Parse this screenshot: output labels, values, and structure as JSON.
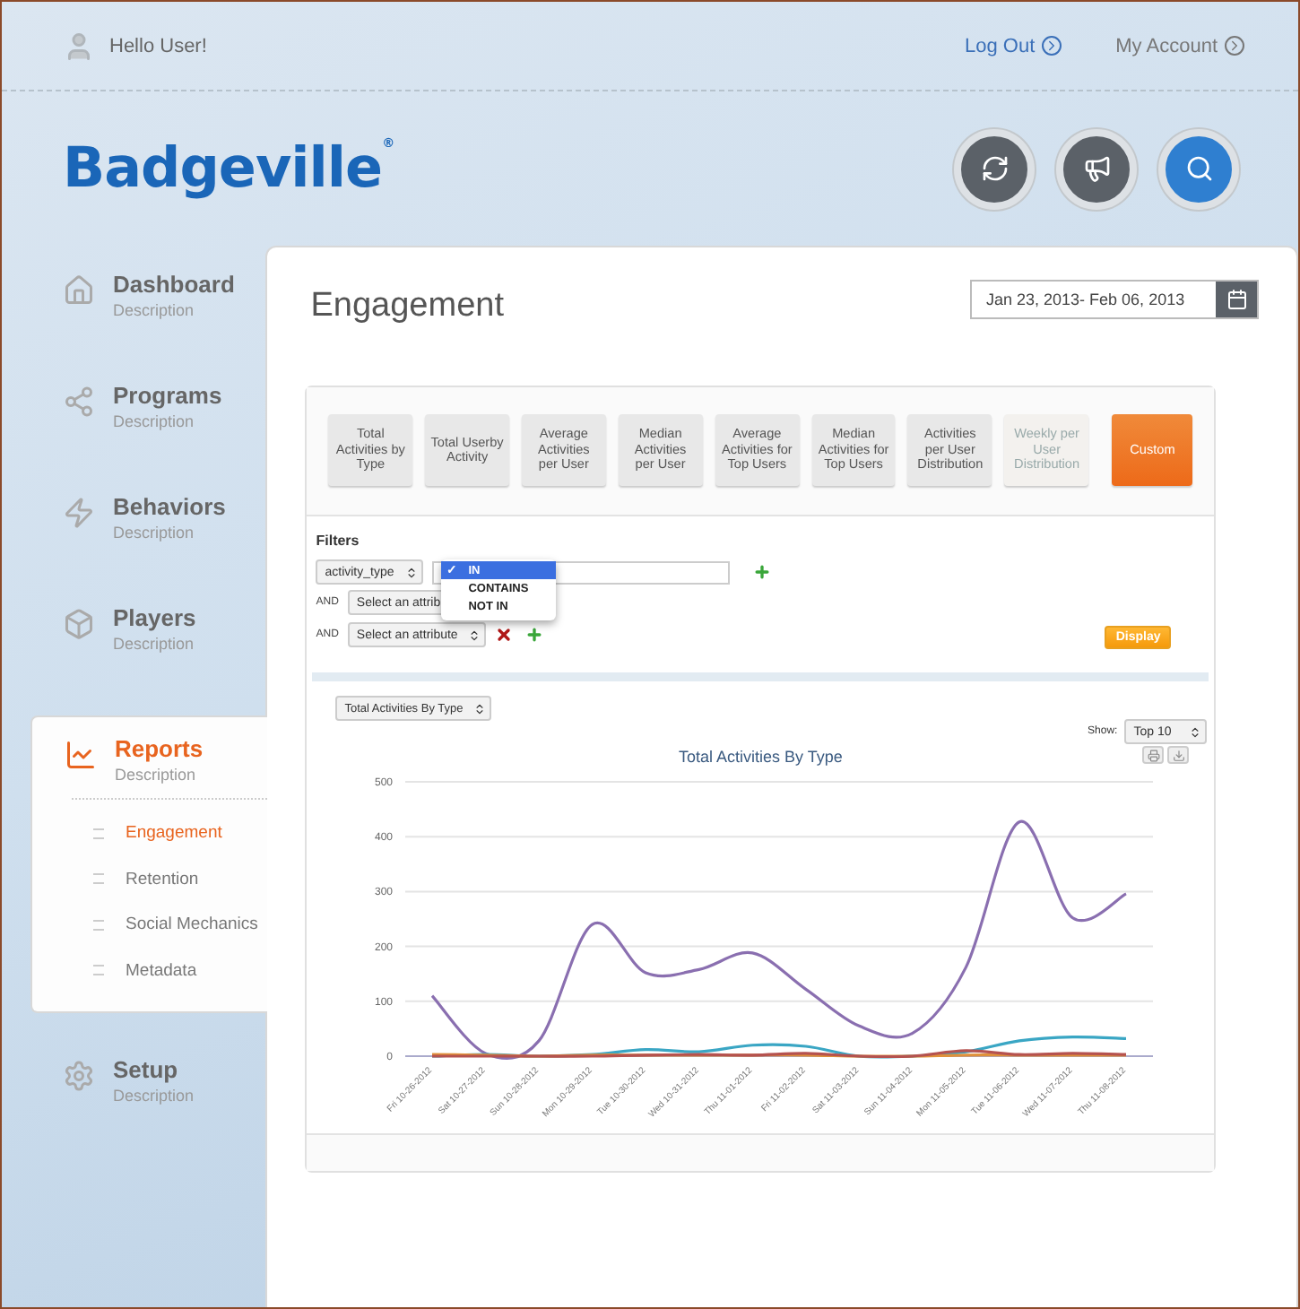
{
  "header": {
    "greeting": "Hello User!",
    "links": [
      {
        "label": "Log Out"
      },
      {
        "label": "My Account"
      }
    ]
  },
  "logo": {
    "text": "Badgeville",
    "mark": "®"
  },
  "sidebar": {
    "items": [
      {
        "title": "Dashboard",
        "description": "Description",
        "selected": false
      },
      {
        "title": "Programs",
        "description": "Description",
        "selected": false
      },
      {
        "title": "Behaviors",
        "description": "Description",
        "selected": false
      },
      {
        "title": "Players",
        "description": "Description",
        "selected": false
      },
      {
        "title": "Reports",
        "description": "Description",
        "selected": true,
        "expanded": true,
        "children": [
          {
            "label": "Engagement",
            "selected": true
          },
          {
            "label": "Retention",
            "selected": false
          },
          {
            "label": "Social Mechanics",
            "selected": false
          },
          {
            "label": "Metadata",
            "selected": false
          }
        ]
      },
      {
        "title": "Setup",
        "description": "Description",
        "selected": false
      }
    ]
  },
  "page": {
    "title": "Engagement",
    "date_range": "Jan 23, 2013- Feb 06, 2013"
  },
  "report_tabs": [
    {
      "label": "Total Activities by Type",
      "selected": false,
      "disabled": false
    },
    {
      "label": "Total Userby Activity",
      "selected": false,
      "disabled": false
    },
    {
      "label": "Average Activities per User",
      "selected": false,
      "disabled": false
    },
    {
      "label": "Median Activities per User",
      "selected": false,
      "disabled": false
    },
    {
      "label": "Average Activities for Top Users",
      "selected": false,
      "disabled": false
    },
    {
      "label": "Median Activities for Top Users",
      "selected": false,
      "disabled": false
    },
    {
      "label": "Activities per User Distribution",
      "selected": false,
      "disabled": false
    },
    {
      "label": "Weekly per User Distribution",
      "selected": false,
      "disabled": true
    },
    {
      "label": "Custom",
      "selected": true,
      "disabled": false
    }
  ],
  "filters": {
    "title": "Filters",
    "rows": [
      {
        "attribute": "activity_type",
        "has_value_field": true,
        "removable": false,
        "addable": true
      },
      {
        "connector": "AND",
        "attribute": "Select an attrib",
        "has_value_field": false
      },
      {
        "connector": "AND",
        "attribute": "Select an attribute",
        "has_value_field": false,
        "removable": true,
        "addable": true
      }
    ],
    "check_mark": "✓",
    "operator_menu": [
      {
        "label": "IN",
        "selected": true
      },
      {
        "label": "CONTAINS",
        "selected": false
      },
      {
        "label": "NOT IN",
        "selected": false
      }
    ],
    "display_button": "Display"
  },
  "report": {
    "type_select": "Total Activities By Type",
    "show_label": "Show:",
    "show_select": "Top 10",
    "chart_data": {
      "type": "line",
      "title": "Total Activities By Type",
      "categories": [
        "Fri 10-26-2012",
        "Sat 10-27-2012",
        "Sun 10-28-2012",
        "Mon 10-29-2012",
        "Tue 10-30-2012",
        "Wed 10-31-2012",
        "Thu 11-01-2012",
        "Fri 11-02-2012",
        "Sat 11-03-2012",
        "Sun 11-04-2012",
        "Mon 11-05-2012",
        "Tue 11-06-2012",
        "Wed 11-07-2012",
        "Thu 11-08-2012"
      ],
      "series": [
        {
          "color": "#8a6fb0",
          "values": [
            110,
            5,
            28,
            240,
            152,
            158,
            188,
            122,
            55,
            42,
            162,
            427,
            252,
            296
          ]
        },
        {
          "color": "#3aa6c4",
          "values": [
            0,
            3,
            0,
            3,
            12,
            8,
            20,
            18,
            0,
            0,
            8,
            28,
            35,
            32
          ]
        },
        {
          "color": "#e0913a",
          "values": [
            3,
            2,
            0,
            2,
            2,
            2,
            2,
            2,
            0,
            0,
            2,
            2,
            2,
            2
          ]
        },
        {
          "color": "#b5524f",
          "values": [
            0,
            0,
            0,
            0,
            2,
            3,
            2,
            5,
            0,
            0,
            10,
            3,
            5,
            3
          ]
        }
      ],
      "grid": true,
      "ylim": [
        0,
        500
      ],
      "yticks": [
        0,
        100,
        200,
        300,
        400,
        500
      ]
    }
  }
}
